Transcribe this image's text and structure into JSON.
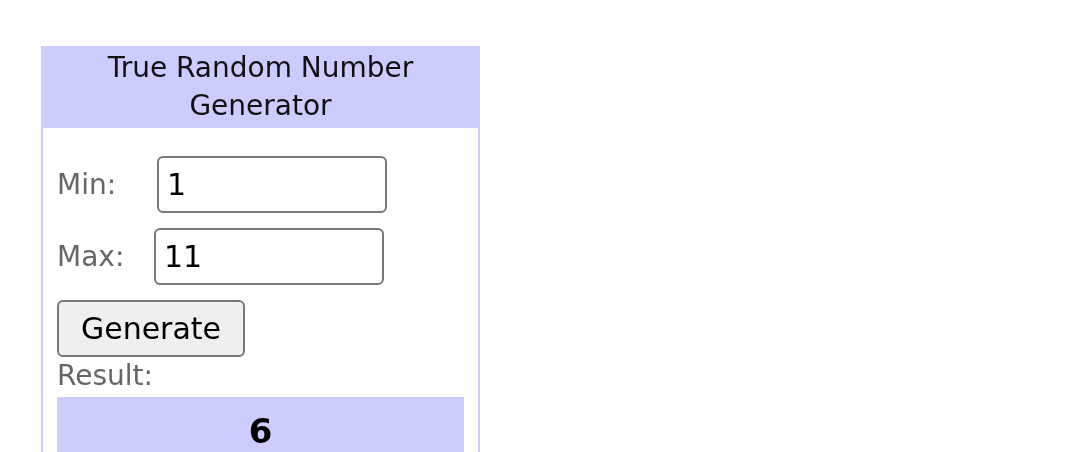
{
  "widget": {
    "title": "True Random Number Generator"
  },
  "fields": [
    {
      "label": "Min:",
      "value": "1"
    },
    {
      "label": "Max:",
      "value": "11"
    }
  ],
  "button": "Generate",
  "result": {
    "label": "Result:",
    "value": "6"
  }
}
